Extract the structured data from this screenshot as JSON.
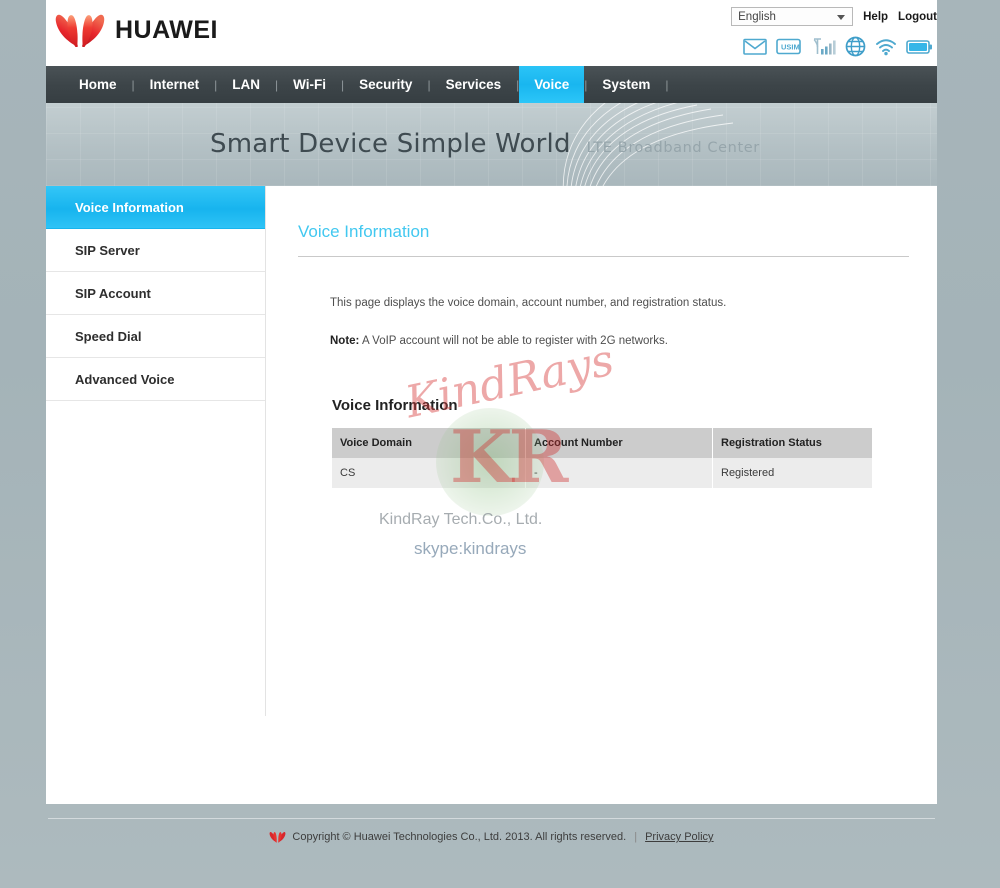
{
  "header": {
    "brand": "HUAWEI",
    "brand_icon": "huawei-flower-logo",
    "language_value": "English",
    "help_label": "Help",
    "logout_label": "Logout",
    "status_icons": [
      {
        "name": "sms-envelope-icon",
        "label": "SMS"
      },
      {
        "name": "usim-card-icon",
        "label": "USIM"
      },
      {
        "name": "signal-bars-icon",
        "label": "Signal"
      },
      {
        "name": "globe-network-icon",
        "label": "Network"
      },
      {
        "name": "wifi-icon",
        "label": "Wi-Fi"
      },
      {
        "name": "battery-icon",
        "label": "Battery"
      }
    ]
  },
  "nav": {
    "items": [
      {
        "label": "Home",
        "active": false
      },
      {
        "label": "Internet",
        "active": false
      },
      {
        "label": "LAN",
        "active": false
      },
      {
        "label": "Wi-Fi",
        "active": false
      },
      {
        "label": "Security",
        "active": false
      },
      {
        "label": "Services",
        "active": false
      },
      {
        "label": "Voice",
        "active": true
      },
      {
        "label": "System",
        "active": false
      }
    ],
    "separator": "|",
    "active_color": "#19b6ef"
  },
  "banner": {
    "headline": "Smart Device  Simple World",
    "subtitle": "LTE Broadband Center"
  },
  "sidebar": {
    "items": [
      {
        "label": "Voice Information",
        "active": true
      },
      {
        "label": "SIP Server",
        "active": false
      },
      {
        "label": "SIP Account",
        "active": false
      },
      {
        "label": "Speed Dial",
        "active": false
      },
      {
        "label": "Advanced Voice",
        "active": false
      }
    ]
  },
  "main": {
    "page_title": "Voice Information",
    "description": "This page displays the voice domain, account number, and registration status.",
    "note_label": "Note:",
    "note_text": " A VoIP account will not be able to register with 2G networks.",
    "section_title": "Voice Information",
    "table": {
      "columns": [
        "Voice Domain",
        "Account Number",
        "Registration Status"
      ],
      "rows": [
        [
          "CS",
          "-",
          "Registered"
        ]
      ]
    }
  },
  "watermark": {
    "script_text": "KindRays",
    "initials": "KR",
    "company": "KindRay Tech.Co., Ltd.",
    "skype": "skype:kindrays"
  },
  "footer": {
    "logo_icon": "huawei-flower-logo",
    "copyright": "Copyright © Huawei Technologies Co., Ltd. 2013. All rights reserved.",
    "separator": "|",
    "privacy_label": "Privacy Policy"
  }
}
